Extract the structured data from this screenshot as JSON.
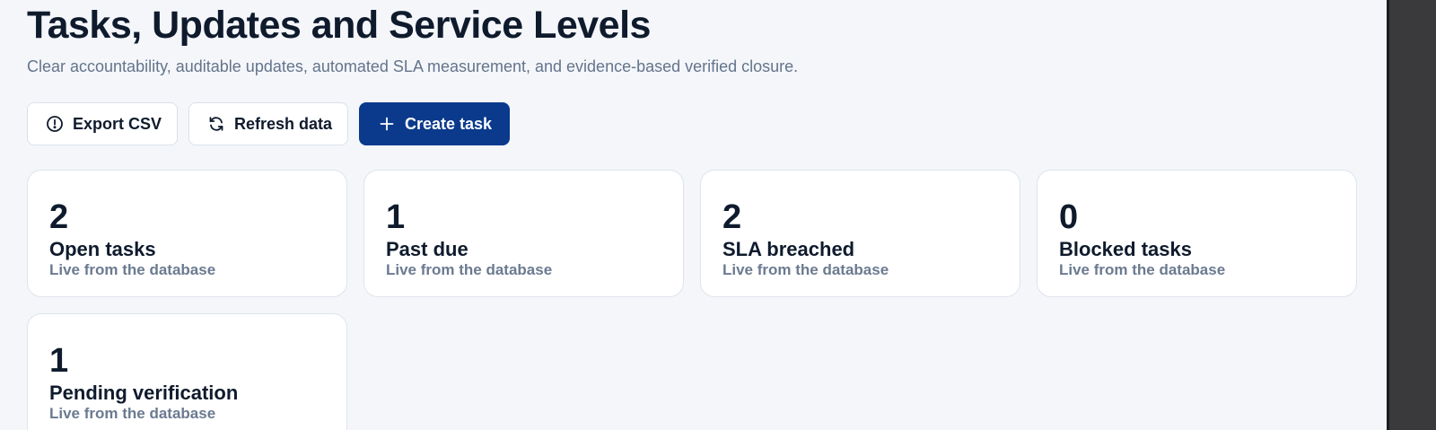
{
  "header": {
    "title": "Tasks, Updates and Service Levels",
    "subtitle": "Clear accountability, auditable updates, automated SLA measurement, and evidence-based verified closure."
  },
  "toolbar": {
    "export_label": "Export CSV",
    "export_icon": "alert-circle-icon",
    "refresh_label": "Refresh data",
    "refresh_icon": "refresh-icon",
    "create_label": "Create task",
    "create_icon": "plus-icon",
    "primary_color": "#0b3a8c"
  },
  "stats": [
    {
      "value": "2",
      "label": "Open tasks",
      "note": "Live from the database"
    },
    {
      "value": "1",
      "label": "Past due",
      "note": "Live from the database"
    },
    {
      "value": "2",
      "label": "SLA breached",
      "note": "Live from the database"
    },
    {
      "value": "0",
      "label": "Blocked tasks",
      "note": "Live from the database"
    },
    {
      "value": "1",
      "label": "Pending verification",
      "note": "Live from the database"
    }
  ]
}
